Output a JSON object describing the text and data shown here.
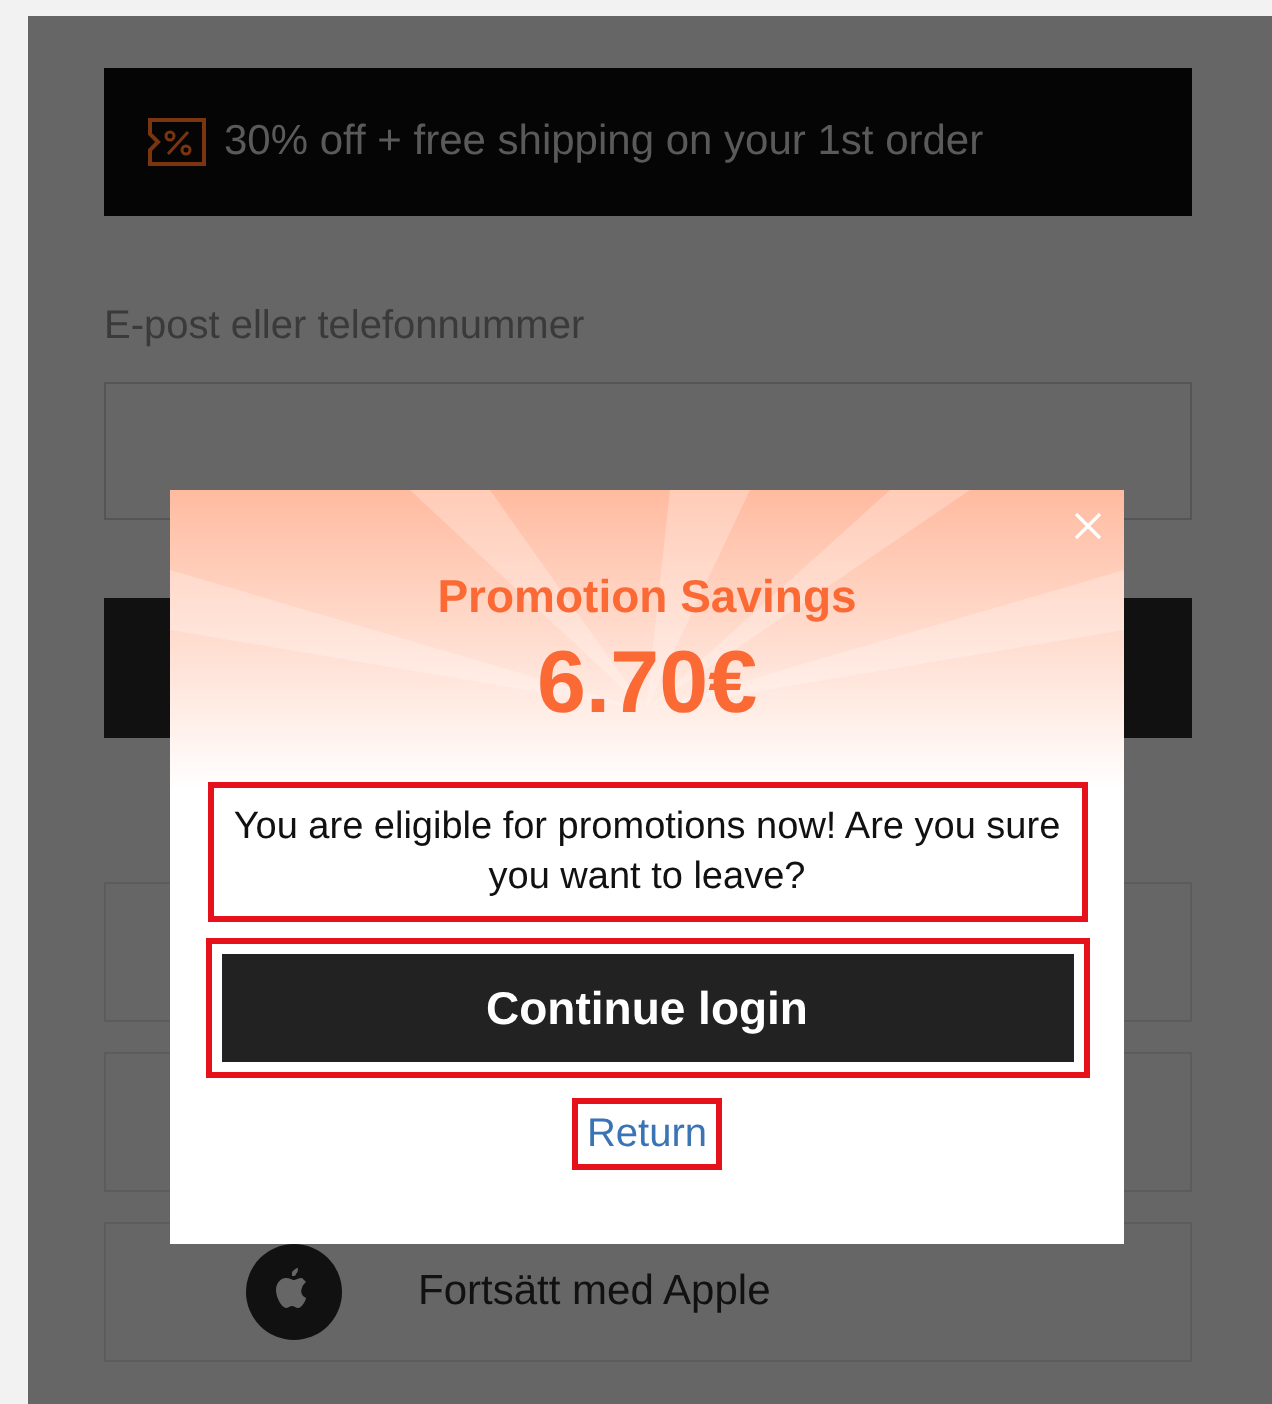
{
  "banner": {
    "text": "30% off + free shipping on your 1st order"
  },
  "login_form": {
    "field_label": "E-post eller telefonnummer",
    "apple_option": "Fortsätt med Apple"
  },
  "dialog": {
    "title": "Promotion Savings",
    "amount": "6.70€",
    "message": {
      "text": "You are eligible for promotions now! Are you sure you want to leave?",
      "highlighted": true
    },
    "primary_button": {
      "label": "Continue login",
      "highlighted": true
    },
    "link": {
      "label": "Return",
      "highlighted": true
    }
  }
}
